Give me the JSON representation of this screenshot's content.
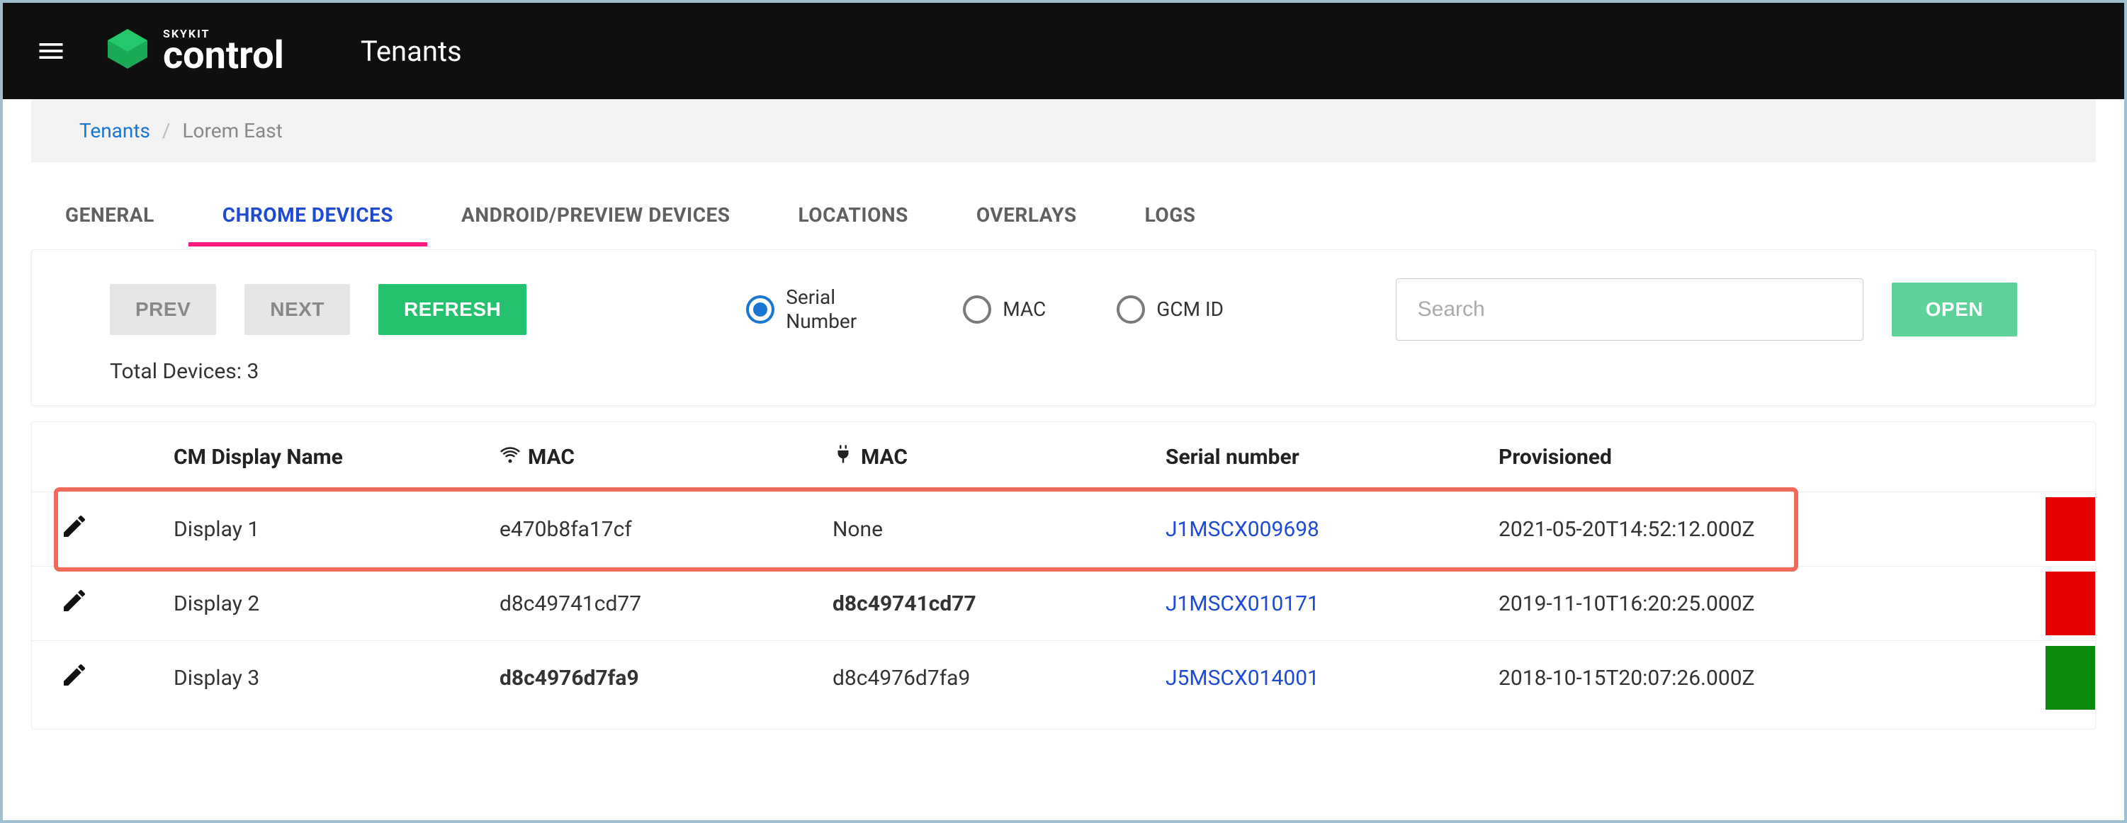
{
  "header": {
    "brand_small": "SKYKIT",
    "brand_big": "control",
    "app_title": "Tenants"
  },
  "breadcrumb": {
    "root": "Tenants",
    "current": "Lorem East"
  },
  "tabs": {
    "general": "GENERAL",
    "chrome": "CHROME DEVICES",
    "android": "ANDROID/PREVIEW DEVICES",
    "locations": "LOCATIONS",
    "overlays": "OVERLAYS",
    "logs": "LOGS",
    "active": "chrome"
  },
  "toolbar": {
    "prev": "PREV",
    "next": "NEXT",
    "refresh": "REFRESH",
    "open": "OPEN",
    "total_prefix": "Total Devices: ",
    "total_count": "3",
    "search_placeholder": "Search",
    "filters": {
      "serial": "Serial Number",
      "mac": "MAC",
      "gcm": "GCM ID",
      "selected": "serial"
    }
  },
  "table": {
    "headers": {
      "name": "CM Display Name",
      "wifi_mac": "MAC",
      "eth_mac": "MAC",
      "serial": "Serial number",
      "provisioned": "Provisioned"
    },
    "rows": [
      {
        "name": "Display 1",
        "wifi_mac": "e470b8fa17cf",
        "wifi_mac_bold": false,
        "eth_mac": "None",
        "eth_mac_bold": false,
        "serial": "J1MSCX009698",
        "provisioned": "2021-05-20T14:52:12.000Z",
        "status_color": "red",
        "highlighted": true
      },
      {
        "name": "Display 2",
        "wifi_mac": "d8c49741cd77",
        "wifi_mac_bold": false,
        "eth_mac": "d8c49741cd77",
        "eth_mac_bold": true,
        "serial": "J1MSCX010171",
        "provisioned": "2019-11-10T16:20:25.000Z",
        "status_color": "red",
        "highlighted": false
      },
      {
        "name": "Display 3",
        "wifi_mac": "d8c4976d7fa9",
        "wifi_mac_bold": true,
        "eth_mac": "d8c4976d7fa9",
        "eth_mac_bold": false,
        "serial": "J5MSCX014001",
        "provisioned": "2018-10-15T20:07:26.000Z",
        "status_color": "green",
        "highlighted": false
      }
    ]
  }
}
